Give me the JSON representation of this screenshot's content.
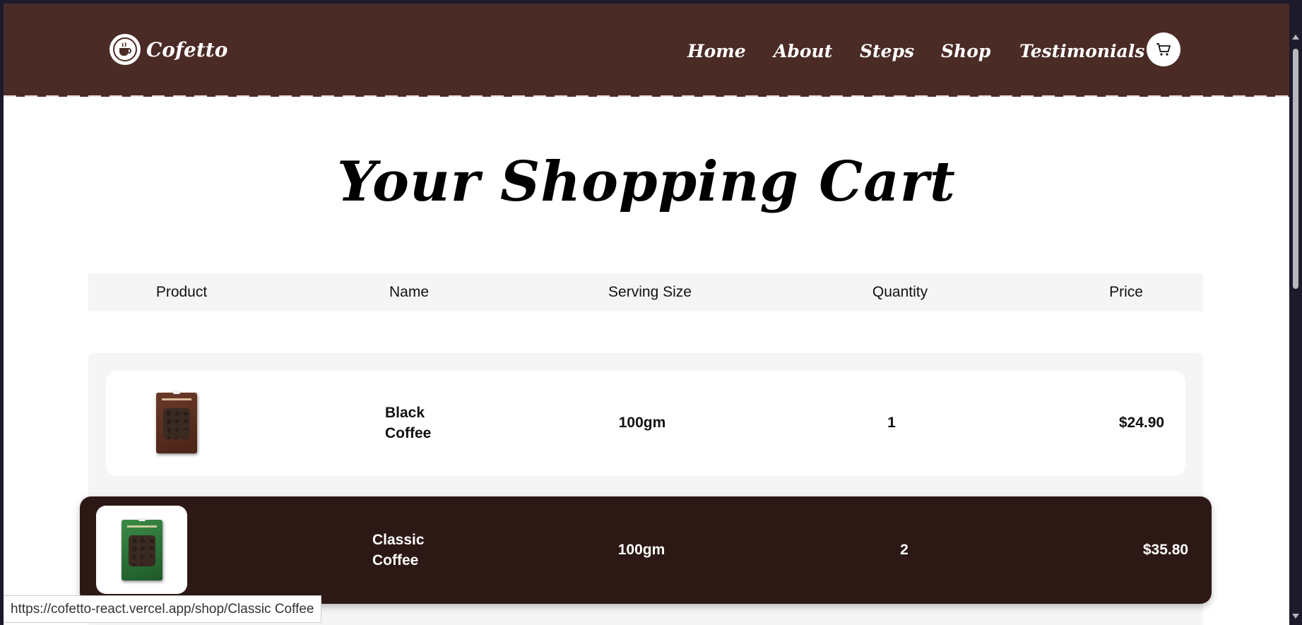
{
  "header": {
    "logo_text": "Cofetto",
    "logo_icon": "coffee-cup-icon",
    "nav": [
      "Home",
      "About",
      "Steps",
      "Shop",
      "Testimonials"
    ],
    "cart_icon": "shopping-cart-icon",
    "background_color": "#4b2b26"
  },
  "page_title": "Your Shopping Cart",
  "table": {
    "headers": [
      "Product",
      "Name",
      "Serving Size",
      "Quantity",
      "Price"
    ],
    "rows": [
      {
        "image": "black-coffee-package",
        "name": "Black Coffee",
        "serving_size": "100gm",
        "quantity": "1",
        "price": "$24.90",
        "pack_color": "#5b3123"
      },
      {
        "image": "classic-coffee-package",
        "name": "Classic Coffee",
        "serving_size": "100gm",
        "quantity": "2",
        "price": "$35.80",
        "pack_color": "#2e6b36",
        "state": "hovered",
        "hover_color": "#2c1814"
      }
    ]
  },
  "status_bar": {
    "url": "https://cofetto-react.vercel.app/shop/Classic Coffee"
  }
}
